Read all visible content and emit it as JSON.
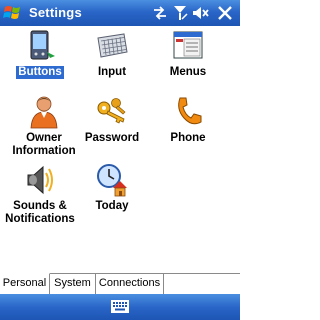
{
  "window": {
    "title": "Settings"
  },
  "status_icons": [
    "connectivity-icon",
    "signal-icon",
    "volume-icon",
    "close-icon"
  ],
  "tiles": [
    {
      "id": "buttons",
      "label": "Buttons",
      "icon": "pda-buttons-icon",
      "selected": true
    },
    {
      "id": "input",
      "label": "Input",
      "icon": "keyboard-icon"
    },
    {
      "id": "menus",
      "label": "Menus",
      "icon": "menu-window-icon"
    },
    {
      "id": "owner",
      "label_line1": "Owner",
      "label_line2": "Information",
      "icon": "person-icon"
    },
    {
      "id": "password",
      "label": "Password",
      "icon": "keys-icon"
    },
    {
      "id": "phone",
      "label": "Phone",
      "icon": "phone-icon"
    },
    {
      "id": "sounds",
      "label_line1": "Sounds &",
      "label_line2": "Notifications",
      "icon": "speaker-icon"
    },
    {
      "id": "today",
      "label": "Today",
      "icon": "clock-home-icon"
    }
  ],
  "tabs": [
    {
      "label": "Personal",
      "active": true
    },
    {
      "label": "System",
      "active": false
    },
    {
      "label": "Connections",
      "active": false
    }
  ],
  "bottom": {
    "input_icon": "soft-keyboard-icon"
  },
  "colors": {
    "titlebar": "#2a66c8",
    "selection": "#2d6bd1"
  }
}
